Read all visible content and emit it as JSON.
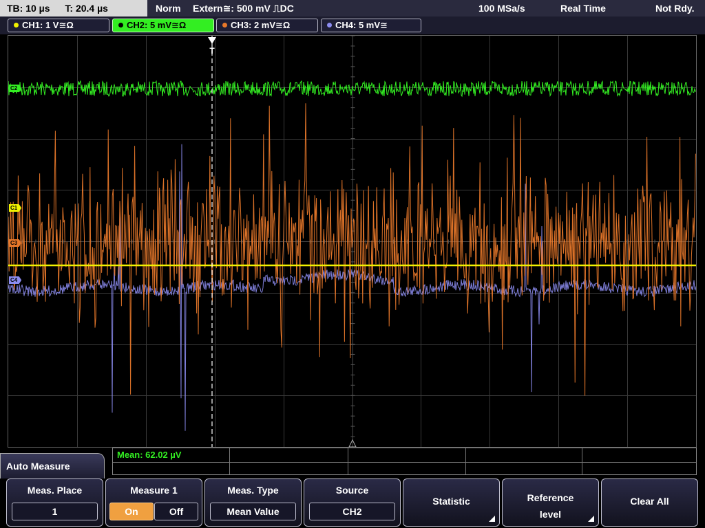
{
  "topbar": {
    "timebase": "TB: 10 µs",
    "trigger_time": "T: 20.4 µs",
    "mode": "Norm",
    "trigger_source": "Extern≅: 500 mV ⎍DC",
    "sample_rate": "100 MSa/s",
    "acq_mode": "Real Time",
    "status": "Not Rdy."
  },
  "channels": [
    {
      "label": "CH1: 1 V≅Ω",
      "color": "#f2f200"
    },
    {
      "label": "CH2: 5 mV≅Ω",
      "color": "#33ee22"
    },
    {
      "label": "CH3: 2 mV≅Ω",
      "color": "#e8782a"
    },
    {
      "label": "CH4: 5 mV≅",
      "color": "#8c8cf0"
    }
  ],
  "markers": {
    "c1": "C1",
    "c2": "C2",
    "c3": "C3",
    "c4": "C4",
    "trigger": "T"
  },
  "measurement": {
    "result": "Mean: 62.02 µV"
  },
  "menu": {
    "title": "Auto Measure",
    "softkeys": {
      "meas_place": {
        "label": "Meas. Place",
        "value": "1"
      },
      "measure1": {
        "label": "Measure 1",
        "on": "On",
        "off": "Off",
        "state": "On"
      },
      "meas_type": {
        "label": "Meas. Type",
        "value": "Mean Value"
      },
      "source": {
        "label": "Source",
        "value": "CH2"
      },
      "statistic": {
        "label": "Statistic"
      },
      "reference_level": {
        "label_line1": "Reference",
        "label_line2": "level"
      },
      "clear_all": {
        "label": "Clear All"
      }
    }
  }
}
